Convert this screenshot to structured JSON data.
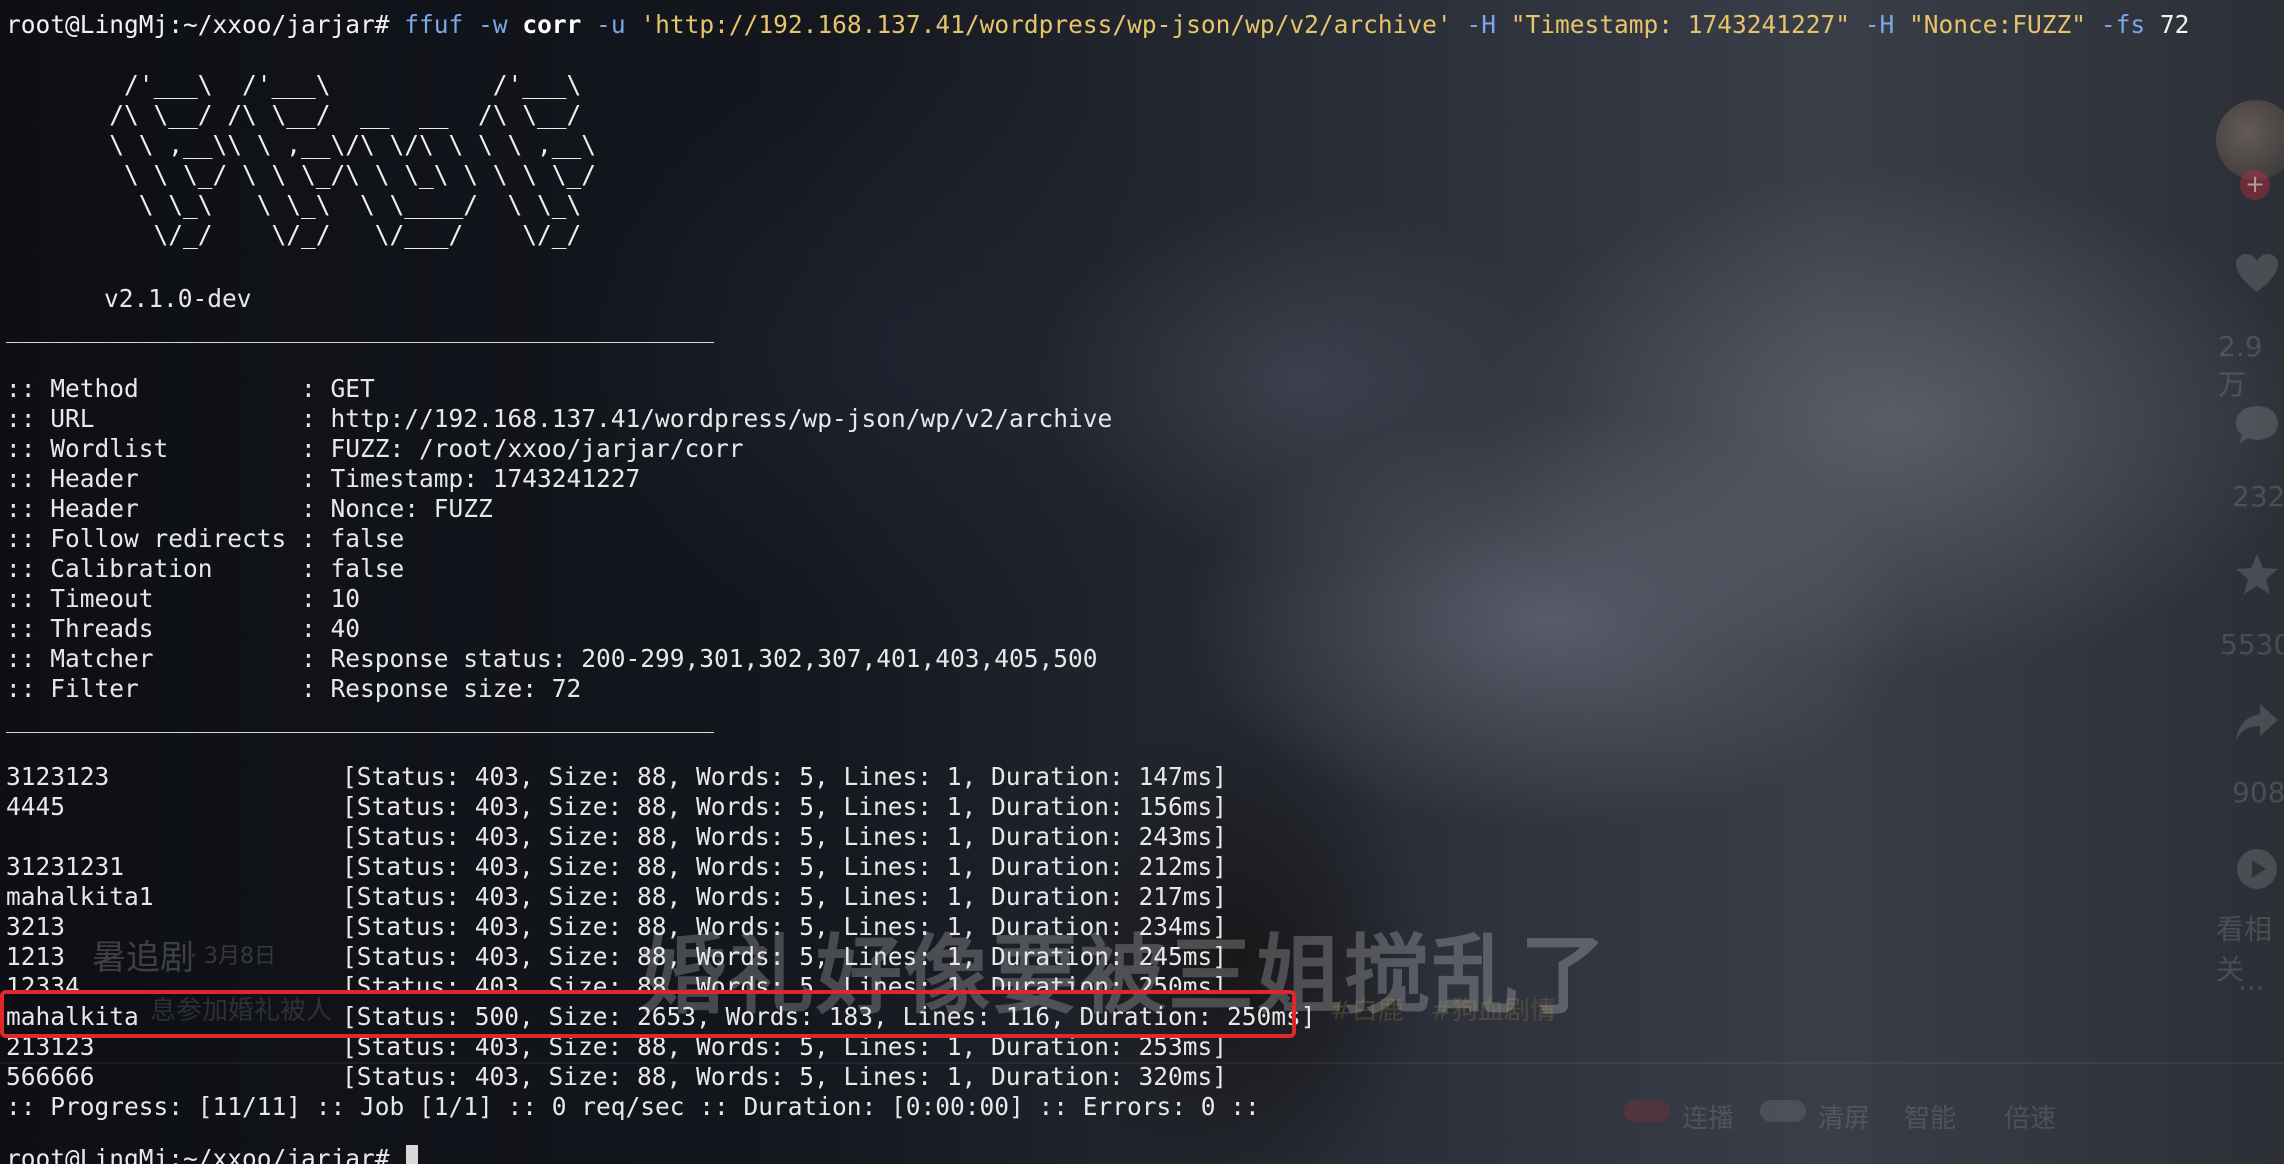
{
  "command": {
    "prompt": "root@LingMj:~/xxoo/jarjar#",
    "program": "ffuf",
    "flag_w": "-w",
    "wordlist": "corr",
    "flag_u": "-u",
    "url_arg": "'http://192.168.137.41/wordpress/wp-json/wp/v2/archive'",
    "flag_h1": "-H",
    "header1_arg": "\"Timestamp: 1743241227\"",
    "flag_h2": "-H",
    "header2_arg": "\"Nonce:FUZZ\"",
    "flag_fs": "-fs",
    "fs_value": "72"
  },
  "banner": {
    "art": [
      "        /'___\\  /'___\\           /'___\\       ",
      "       /\\ \\__/ /\\ \\__/  __  __  /\\ \\__/       ",
      "       \\ \\ ,__\\\\ \\ ,__\\/\\ \\/\\ \\ \\ \\ ,__\\      ",
      "        \\ \\ \\_/ \\ \\ \\_/\\ \\ \\_\\ \\ \\ \\ \\_/      ",
      "         \\ \\_\\   \\ \\_\\  \\ \\____/  \\ \\_\\       ",
      "          \\/_/    \\/_/   \\/___/    \\/_/       "
    ],
    "version": "v2.1.0-dev"
  },
  "rule": "________________________________________________",
  "config": [
    {
      "key": ":: Method           ",
      "value": ": GET"
    },
    {
      "key": ":: URL              ",
      "value": ": http://192.168.137.41/wordpress/wp-json/wp/v2/archive"
    },
    {
      "key": ":: Wordlist         ",
      "value": ": FUZZ: /root/xxoo/jarjar/corr"
    },
    {
      "key": ":: Header           ",
      "value": ": Timestamp: 1743241227"
    },
    {
      "key": ":: Header           ",
      "value": ": Nonce: FUZZ"
    },
    {
      "key": ":: Follow redirects ",
      "value": ": false"
    },
    {
      "key": ":: Calibration      ",
      "value": ": false"
    },
    {
      "key": ":: Timeout          ",
      "value": ": 10"
    },
    {
      "key": ":: Threads          ",
      "value": ": 40"
    },
    {
      "key": ":: Matcher          ",
      "value": ": Response status: 200-299,301,302,307,401,403,405,500"
    },
    {
      "key": ":: Filter           ",
      "value": ": Response size: 72"
    }
  ],
  "results": [
    {
      "word": "3123123",
      "info": "[Status: 403, Size: 88, Words: 5, Lines: 1, Duration: 147ms]"
    },
    {
      "word": "4445",
      "info": "[Status: 403, Size: 88, Words: 5, Lines: 1, Duration: 156ms]"
    },
    {
      "word": "",
      "info": "[Status: 403, Size: 88, Words: 5, Lines: 1, Duration: 243ms]"
    },
    {
      "word": "31231231",
      "info": "[Status: 403, Size: 88, Words: 5, Lines: 1, Duration: 212ms]"
    },
    {
      "word": "mahalkita1",
      "info": "[Status: 403, Size: 88, Words: 5, Lines: 1, Duration: 217ms]"
    },
    {
      "word": "3213",
      "info": "[Status: 403, Size: 88, Words: 5, Lines: 1, Duration: 234ms]"
    },
    {
      "word": "1213",
      "info": "[Status: 403, Size: 88, Words: 5, Lines: 1, Duration: 245ms]"
    },
    {
      "word": "12334",
      "info": "[Status: 403, Size: 88, Words: 5, Lines: 1, Duration: 250ms]"
    },
    {
      "word": "mahalkita",
      "info": "[Status: 500, Size: 2653, Words: 183, Lines: 116, Duration: 250ms]"
    },
    {
      "word": "213123",
      "info": "[Status: 403, Size: 88, Words: 5, Lines: 1, Duration: 253ms]"
    },
    {
      "word": "566666",
      "info": "[Status: 403, Size: 88, Words: 5, Lines: 1, Duration: 320ms]"
    }
  ],
  "progress": ":: Progress: [11/11] :: Job [1/1] :: 0 req/sec :: Duration: [0:00:00] :: Errors: 0 ::",
  "final_prompt": "root@LingMj:~/xxoo/jarjar#",
  "highlight_color": "#e0282c",
  "video_overlay": {
    "title": "婚礼好像要被三姐搅乱了",
    "author": "暑追剧",
    "date": "· 3月8日",
    "description": "息参加婚礼被人",
    "tags": [
      "#白鹿",
      "#狗血剧情"
    ],
    "side_counts": [
      "2.9万",
      "232",
      "5530",
      "908"
    ],
    "side_more": "看相关",
    "controls": [
      "连播",
      "清屏",
      "智能",
      "倍速"
    ]
  }
}
